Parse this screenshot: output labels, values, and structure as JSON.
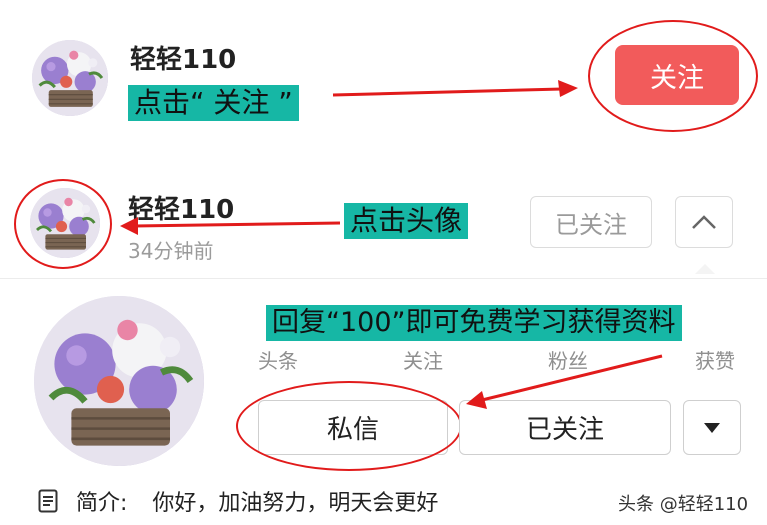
{
  "top_row": {
    "username": "轻轻110",
    "hint": "点击“ 关注 ”",
    "follow_button": "关注"
  },
  "second_row": {
    "username": "轻轻110",
    "time": "34分钟前",
    "hint": "点击头像",
    "followed_button": "已关注"
  },
  "profile": {
    "promo_text": "回复“100”即可免费学习获得资料",
    "stats": [
      "头条",
      "关注",
      "粉丝",
      "获赞"
    ],
    "message_button": "私信",
    "followed_button": "已关注",
    "bio_label": "简介:",
    "bio_text": "你好，加油努力，明天会更好"
  },
  "watermark": "头条 @轻轻110",
  "colors": {
    "follow_red": "#f25b5b",
    "highlight_teal": "#16b7a5",
    "annotation_red": "#e11b1b"
  }
}
